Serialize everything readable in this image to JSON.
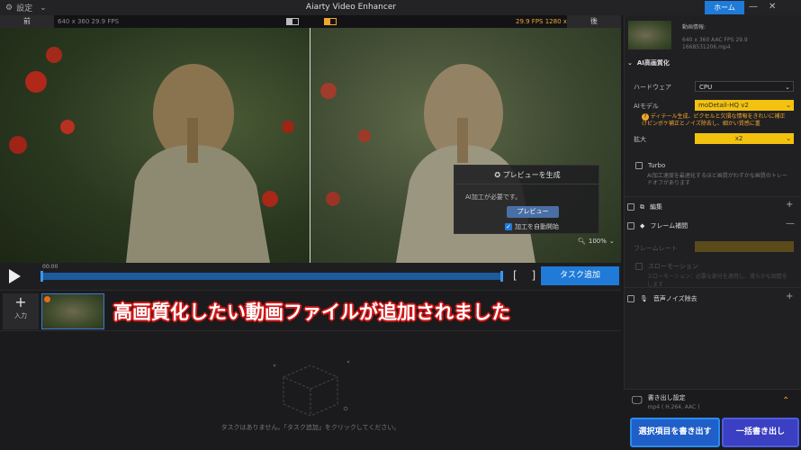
{
  "titlebar": {
    "settings_label": "設定",
    "app_title": "Aiarty Video Enhancer",
    "home_label": "ホーム"
  },
  "preview": {
    "before_label": "前",
    "after_label": "後",
    "input_info": "640 x 360  29.9 FPS",
    "output_info": "29.9 FPS  1280 x 720",
    "zoom_level": "100%"
  },
  "popup": {
    "title": "プレビューを生成",
    "message": "AI加工が必要です。",
    "preview_button": "プレビュー",
    "auto_start_label": "加工を自動開始"
  },
  "playback": {
    "timecode": "00:00",
    "task_add_label": "タスク追加"
  },
  "tasks": {
    "add_label": "入力",
    "banner_text": "高画質化したい動画ファイルが追加されました",
    "empty_message": "タスクはありません。「タスク追加」をクリックしてください。"
  },
  "file_info": {
    "header": "動画情報:",
    "line1": "640 x 360   AAC   FPS 29.9",
    "line2": "1668531206.mp4"
  },
  "ai_section": {
    "title": "AI高画質化",
    "hardware_label": "ハードウェア",
    "hardware_value": "CPU",
    "model_label": "AIモデル",
    "model_value": "moDetail-HQ  v2",
    "model_desc": "ディテール生成、ピクセルと欠損な情報をきれいに補正けピンボケ補正とノイズ除去し、細かい質感に重",
    "scale_label": "拡大",
    "scale_value": "x2",
    "turbo_label": "Turbo",
    "turbo_desc": "AI加工速度を最適化するほど画質がわずかな画質のトレードオフがあります"
  },
  "edit_section": {
    "title": "編集"
  },
  "frame_section": {
    "title": "フレーム補間",
    "framerate_label": "フレームレート",
    "slowmo_label": "スローモーション",
    "slowmo_desc": "スローモーション：必要な部分を適用し、滑らかな調整をします"
  },
  "audio_section": {
    "title": "音声ノイズ除去"
  },
  "export": {
    "settings_label": "書き出し設定",
    "format": "mp4 ( H.264, AAC )",
    "export_selected": "選択項目を書き出す",
    "export_all": "一括書き出し"
  },
  "colors": {
    "accent": "#1f7ad8",
    "highlight": "#f2a52a",
    "banner_outline": "#d01919"
  }
}
